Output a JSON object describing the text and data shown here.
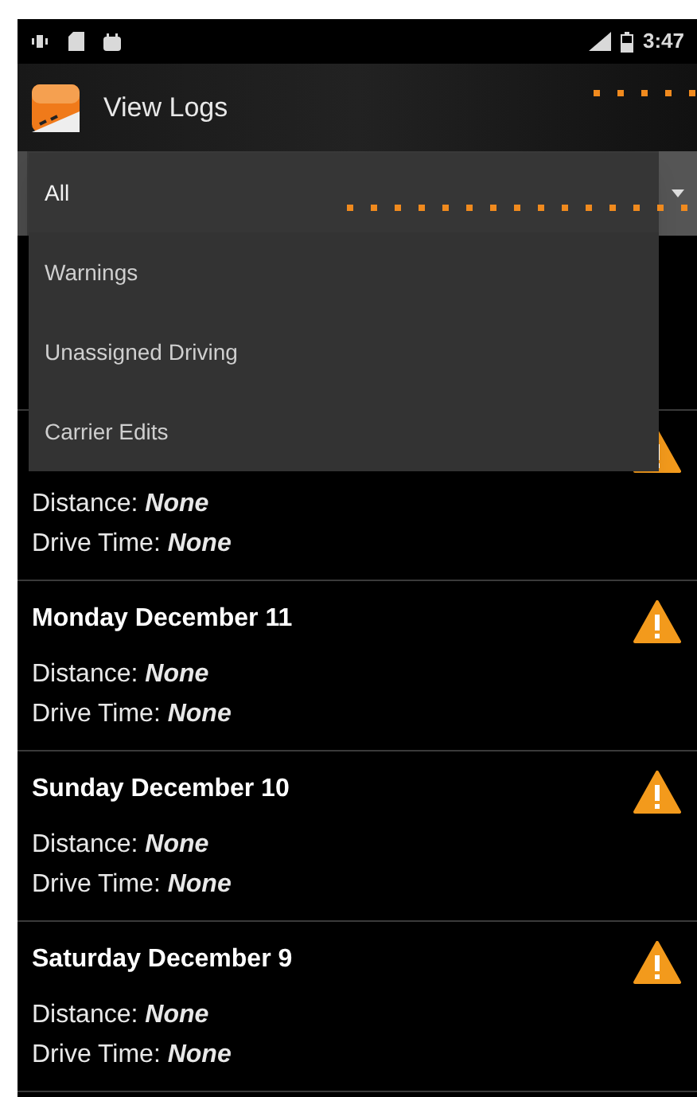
{
  "status_bar": {
    "time": "3:47"
  },
  "app_bar": {
    "title": "View Logs"
  },
  "filter": {
    "expanded": true,
    "options": [
      {
        "label": "All",
        "selected": true
      },
      {
        "label": "Warnings",
        "selected": false
      },
      {
        "label": "Unassigned Driving",
        "selected": false
      },
      {
        "label": "Carrier Edits",
        "selected": false
      }
    ]
  },
  "logs": [
    {
      "distance_label": "Distance:",
      "distance": "None",
      "drive_time_label": "Drive Time:",
      "drive_time": "None",
      "warning": true
    },
    {
      "date": "Monday December 11",
      "distance_label": "Distance:",
      "distance": "None",
      "drive_time_label": "Drive Time:",
      "drive_time": "None",
      "warning": true
    },
    {
      "date": "Sunday December 10",
      "distance_label": "Distance:",
      "distance": "None",
      "drive_time_label": "Drive Time:",
      "drive_time": "None",
      "warning": true
    },
    {
      "date": "Saturday December 9",
      "distance_label": "Distance:",
      "distance": "None",
      "drive_time_label": "Drive Time:",
      "drive_time": "None",
      "warning": true
    }
  ]
}
